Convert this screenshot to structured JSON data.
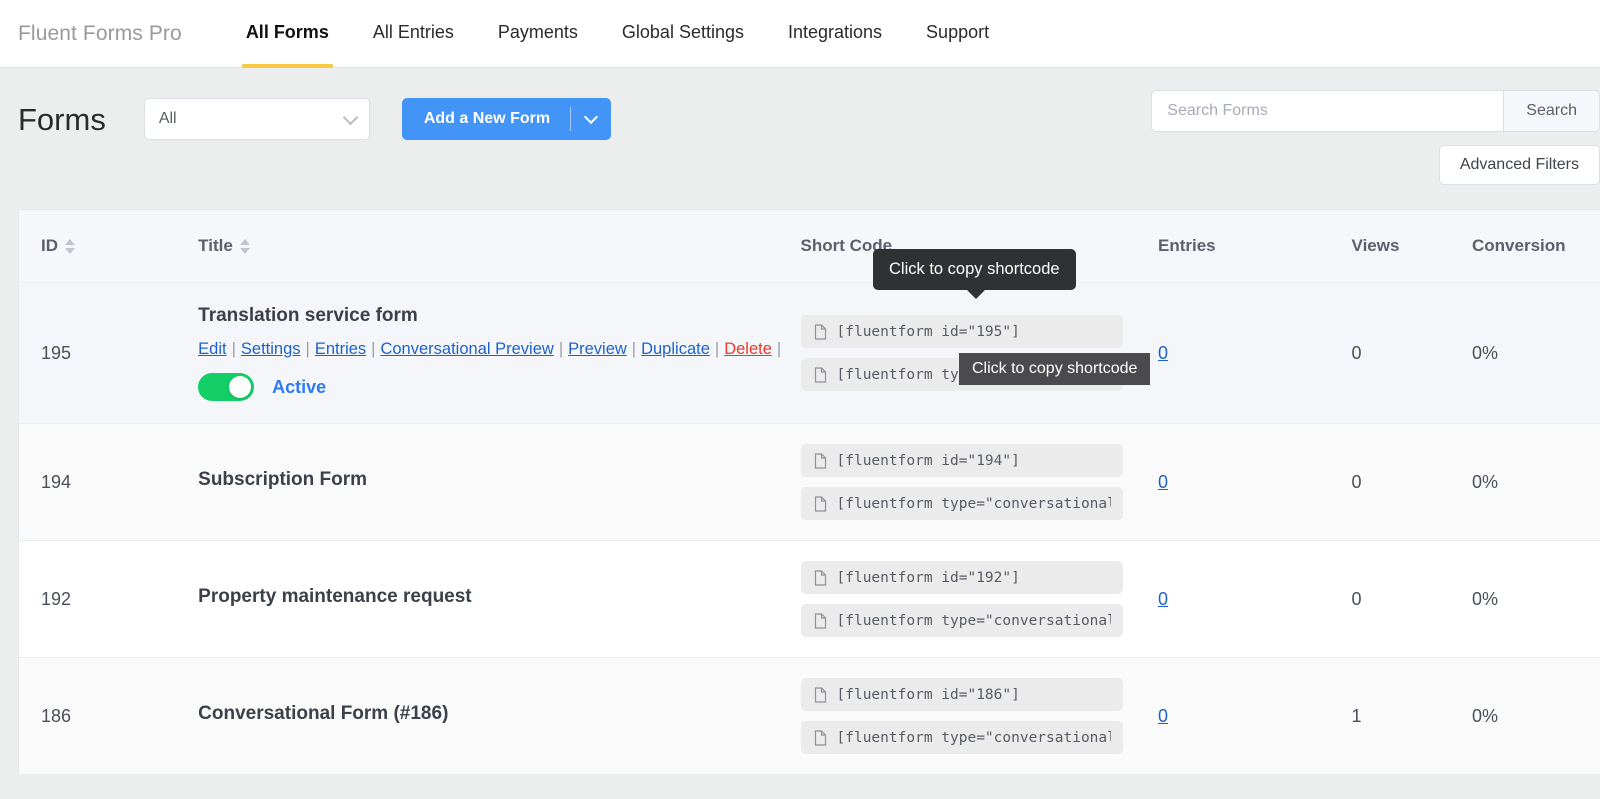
{
  "nav": {
    "brand": "Fluent Forms Pro",
    "items": [
      {
        "label": "All Forms",
        "active": true
      },
      {
        "label": "All Entries",
        "active": false
      },
      {
        "label": "Payments",
        "active": false
      },
      {
        "label": "Global Settings",
        "active": false
      },
      {
        "label": "Integrations",
        "active": false
      },
      {
        "label": "Support",
        "active": false
      }
    ],
    "active_underline_color": "#fbc843"
  },
  "toolbar": {
    "page_title": "Forms",
    "filter_value": "All",
    "filter_icon": "chevron-down-icon",
    "add_button_label": "Add a New Form",
    "add_button_caret_icon": "chevron-down-icon",
    "add_button_color": "#4294f7",
    "search_placeholder": "Search Forms",
    "search_value": "",
    "search_button_label": "Search",
    "advanced_filters_label": "Advanced Filters"
  },
  "table": {
    "headers": {
      "id": "ID",
      "title": "Title",
      "short_code": "Short Code",
      "entries": "Entries",
      "views": "Views",
      "conversion": "Conversion"
    },
    "sortable": [
      "id",
      "title"
    ],
    "actions": {
      "edit": "Edit",
      "settings": "Settings",
      "entries": "Entries",
      "conversational_preview": "Conversational Preview",
      "preview": "Preview",
      "duplicate": "Duplicate",
      "delete": "Delete",
      "separator": "|"
    },
    "rows": [
      {
        "id": "195",
        "title": "Translation service form",
        "has_actions": true,
        "status_label": "Active",
        "status_on": true,
        "shortcodes": [
          "[fluentform id=\"195\"]",
          "[fluentform type=\"conversational\""
        ],
        "entries": "0",
        "views": "0",
        "conversion": "0%"
      },
      {
        "id": "194",
        "title": "Subscription Form",
        "has_actions": false,
        "shortcodes": [
          "[fluentform id=\"194\"]",
          "[fluentform type=\"conversational\""
        ],
        "entries": "0",
        "views": "0",
        "conversion": "0%"
      },
      {
        "id": "192",
        "title": "Property maintenance request",
        "has_actions": false,
        "shortcodes": [
          "[fluentform id=\"192\"]",
          "[fluentform type=\"conversational\""
        ],
        "entries": "0",
        "views": "0",
        "conversion": "0%"
      },
      {
        "id": "186",
        "title": "Conversational Form (#186)",
        "has_actions": false,
        "shortcodes": [
          "[fluentform id=\"186\"]",
          "[fluentform type=\"conversational\""
        ],
        "entries": "0",
        "views": "1",
        "conversion": "0%"
      }
    ]
  },
  "tooltips": {
    "primary": "Click to copy shortcode",
    "secondary": "Click to copy shortcode"
  }
}
